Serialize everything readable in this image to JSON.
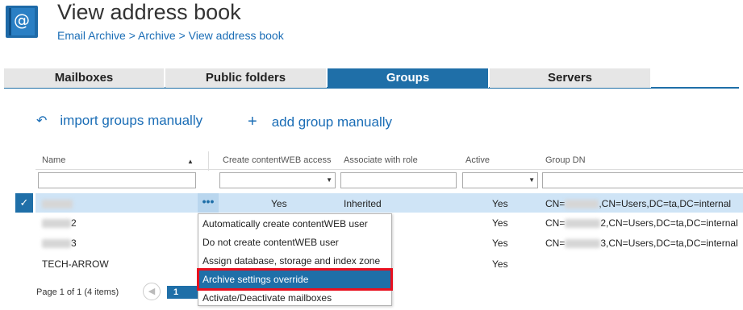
{
  "header": {
    "title": "View address book",
    "breadcrumb": [
      "Email Archive",
      ">",
      "Archive",
      ">",
      "View address book"
    ],
    "logo_icon": "address-book-icon"
  },
  "tabs": [
    {
      "label": "Mailboxes",
      "active": false
    },
    {
      "label": "Public folders",
      "active": false
    },
    {
      "label": "Groups",
      "active": true
    },
    {
      "label": "Servers",
      "active": false
    }
  ],
  "actions": {
    "import": {
      "icon": "undo-arrow-icon",
      "label": "import groups manually"
    },
    "add": {
      "icon": "plus-icon",
      "label": "add group manually"
    }
  },
  "table": {
    "columns": [
      "Name",
      "Create contentWEB access",
      "Associate with role",
      "Active",
      "Group DN"
    ],
    "rows": [
      {
        "name": "",
        "create_access": "Yes",
        "role": "Inherited",
        "active": "Yes",
        "dn_prefix": "CN=",
        "dn_suffix": ",CN=Users,DC=ta,DC=internal",
        "selected": true
      },
      {
        "name": "2",
        "create_access": "",
        "role": "",
        "active": "Yes",
        "dn_prefix": "CN=",
        "dn_suffix": "2,CN=Users,DC=ta,DC=internal",
        "selected": false
      },
      {
        "name": "3",
        "create_access": "",
        "role": "",
        "active": "Yes",
        "dn_prefix": "CN=",
        "dn_suffix": "3,CN=Users,DC=ta,DC=internal",
        "selected": false
      },
      {
        "name": "TECH-ARROW",
        "create_access": "",
        "role": "",
        "active": "Yes",
        "dn_prefix": "",
        "dn_suffix": "",
        "selected": false
      }
    ],
    "row_menu_icon": "ellipsis-icon",
    "check_icon": "checkmark-icon"
  },
  "context_menu": {
    "items": [
      "Automatically create contentWEB user",
      "Do not create contentWEB user",
      "Assign database, storage and index zone",
      "Archive settings override",
      "Activate/Deactivate mailboxes"
    ],
    "highlighted_index": 3
  },
  "pager": {
    "text": "Page 1 of 1 (4 items)",
    "current_page": "1",
    "prev_icon": "chevron-left-icon"
  },
  "colors": {
    "accent": "#1f6fa8",
    "link": "#1a6db6",
    "selected_row": "#cfe4f6",
    "highlight_border": "#e8101f"
  }
}
